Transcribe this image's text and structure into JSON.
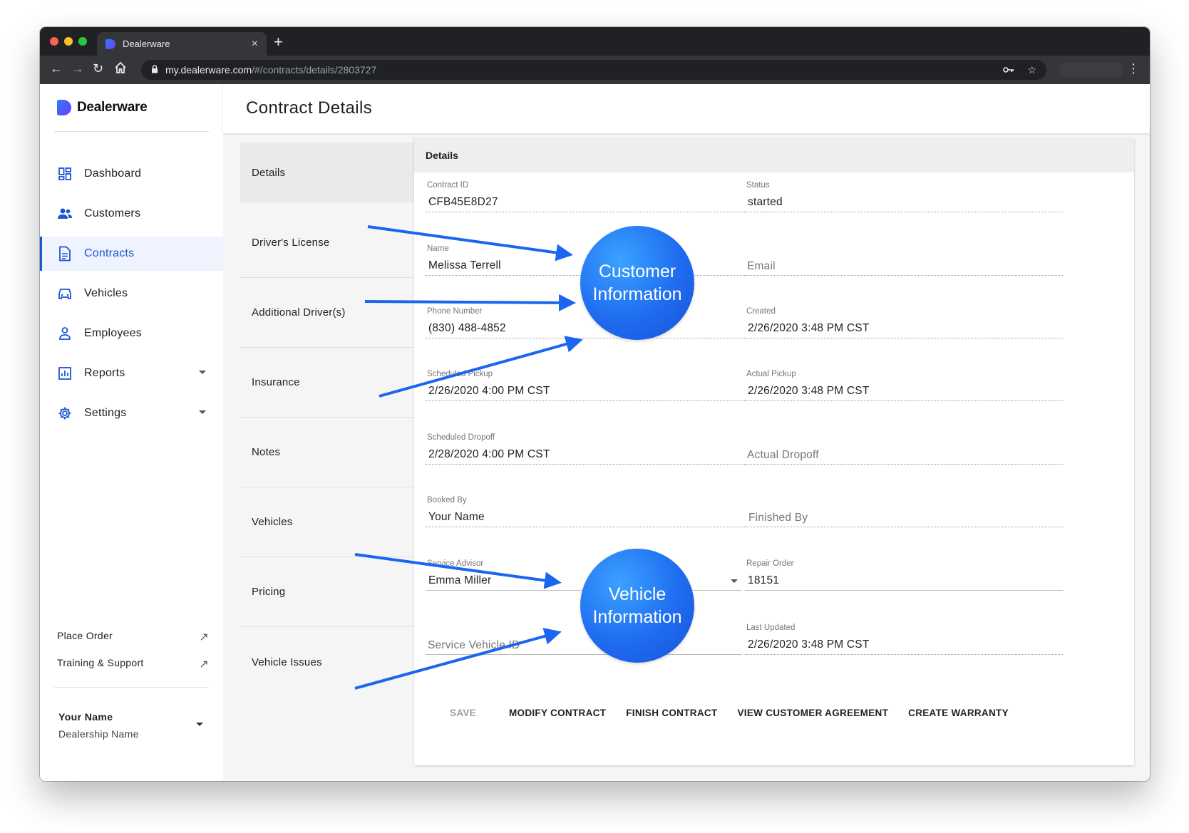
{
  "browser": {
    "tab_title": "Dealerware",
    "tab_close": "×",
    "new_tab": "+",
    "url_host": "my.dealerware.com",
    "url_path": "/#/contracts/details/2803727"
  },
  "sidebar": {
    "brand": "Dealerware",
    "items": [
      {
        "label": "Dashboard",
        "icon": "dashboard-icon"
      },
      {
        "label": "Customers",
        "icon": "people-icon"
      },
      {
        "label": "Contracts",
        "icon": "document-icon",
        "active": true
      },
      {
        "label": "Vehicles",
        "icon": "car-icon"
      },
      {
        "label": "Employees",
        "icon": "person-icon"
      },
      {
        "label": "Reports",
        "icon": "bar-chart-icon"
      },
      {
        "label": "Settings",
        "icon": "gear-icon"
      }
    ],
    "links": [
      {
        "label": "Place Order",
        "icon": "external-link-icon"
      },
      {
        "label": "Training & Support",
        "icon": "external-link-icon"
      }
    ],
    "user": {
      "name": "Your Name",
      "dealership": "Dealership Name"
    }
  },
  "page": {
    "title": "Contract Details"
  },
  "subnav": [
    "Details",
    "Driver's License",
    "Additional Driver(s)",
    "Insurance",
    "Notes",
    "Vehicles",
    "Pricing",
    "Vehicle Issues"
  ],
  "details": {
    "header": "Details",
    "contract_id": {
      "label": "Contract ID",
      "value": "CFB45E8D27"
    },
    "status": {
      "label": "Status",
      "value": "started"
    },
    "name": {
      "label": "Name",
      "value": "Melissa Terrell"
    },
    "email": {
      "placeholder": "Email"
    },
    "phone": {
      "label": "Phone Number",
      "value": "(830) 488-4852"
    },
    "created": {
      "label": "Created",
      "value": "2/26/2020 3:48 PM CST"
    },
    "scheduled_pickup": {
      "label": "Scheduled Pickup",
      "value": "2/26/2020 4:00 PM CST"
    },
    "actual_pickup": {
      "label": "Actual Pickup",
      "value": "2/26/2020 3:48 PM CST"
    },
    "scheduled_dropoff": {
      "label": "Scheduled Dropoff",
      "value": "2/28/2020 4:00 PM CST"
    },
    "actual_dropoff": {
      "placeholder": "Actual Dropoff"
    },
    "booked_by": {
      "label": "Booked By",
      "value": "Your Name"
    },
    "finished_by": {
      "placeholder": "Finished By"
    },
    "service_advisor": {
      "label": "Service Advisor",
      "value": "Emma Miller"
    },
    "repair_order": {
      "label": "Repair Order",
      "value": "18151"
    },
    "service_vehicle_id": {
      "placeholder": "Service Vehicle ID"
    },
    "last_updated": {
      "label": "Last Updated",
      "value": "2/26/2020 3:48 PM CST"
    }
  },
  "actions": {
    "save": "SAVE",
    "modify": "MODIFY CONTRACT",
    "finish": "FINISH CONTRACT",
    "view_agreement": "VIEW CUSTOMER AGREEMENT",
    "warranty": "CREATE WARRANTY"
  },
  "annotations": {
    "customer_line1": "Customer",
    "customer_line2": "Information",
    "vehicle_line1": "Vehicle",
    "vehicle_line2": "Information",
    "color": "#1a66f0"
  },
  "colors": {
    "accent": "#1a56d6",
    "browser_dark": "#202124",
    "browser_toolbar": "#35363a"
  }
}
